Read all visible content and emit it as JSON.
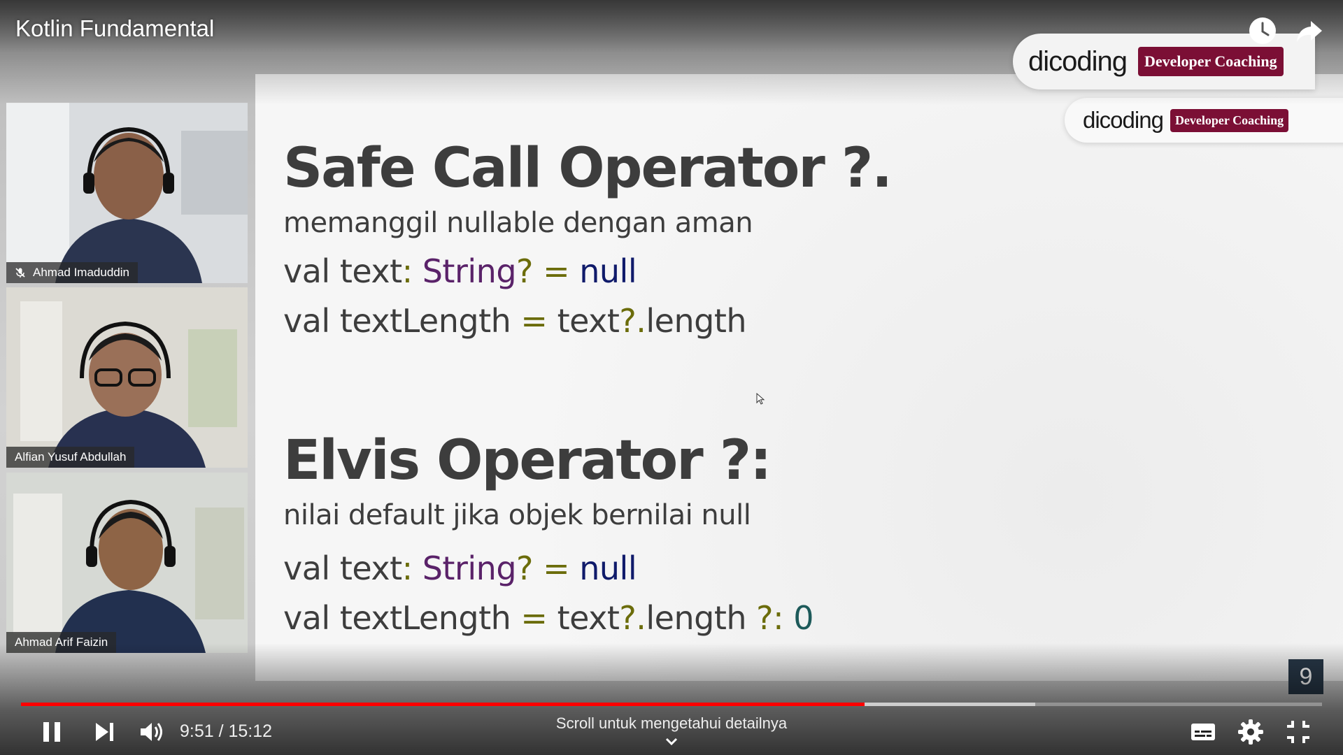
{
  "video": {
    "title": "Kotlin Fundamental"
  },
  "brand": {
    "wordmark": "dicoding",
    "badge": "Developer Coaching",
    "badge_color": "#7b0f35"
  },
  "slide": {
    "safe_call": {
      "heading": "Safe Call Operator ?.",
      "subtitle": "memanggil nullable dengan aman",
      "line1": {
        "a": "val text",
        "b": ":",
        "c": "String",
        "d": "?",
        "e": "=",
        "f": "null"
      },
      "line2": {
        "a": "val textLength",
        "b": "=",
        "c": "text",
        "d": "?.",
        "e": "length"
      }
    },
    "elvis": {
      "heading": "Elvis Operator ?:",
      "subtitle": "nilai default jika objek bernilai null",
      "line1": {
        "a": "val text",
        "b": ":",
        "c": "String",
        "d": "?",
        "e": "=",
        "f": "null"
      },
      "line2": {
        "a": "val textLength",
        "b": "=",
        "c": "text",
        "d": "?.",
        "e": "length",
        "f": "?:",
        "g": "0"
      }
    },
    "slide_number": "9"
  },
  "participants": [
    {
      "name": "Ahmad Imaduddin",
      "muted": true
    },
    {
      "name": "Alfian Yusuf Abdullah",
      "muted": false
    },
    {
      "name": "Ahmad Arif Faizin",
      "muted": false
    }
  ],
  "controls": {
    "time": "9:51 / 15:12",
    "scroll_hint": "Scroll untuk mengetahui detailnya",
    "progress_played": 0.6486,
    "progress_buffered": 0.7795,
    "progress_color": "#ff0000"
  },
  "icons": {
    "top_right": [
      "clock-icon",
      "share-arrow-icon"
    ],
    "controls_left": [
      "pause-icon",
      "skip-next-icon",
      "volume-icon"
    ],
    "controls_right": [
      "subtitles-icon",
      "gear-icon",
      "exit-fullscreen-icon"
    ]
  }
}
